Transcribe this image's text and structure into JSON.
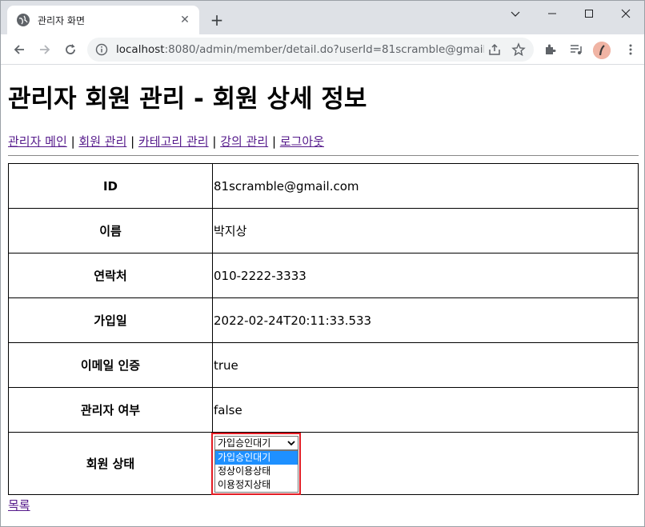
{
  "browser": {
    "tab_title": "관리자 화면",
    "new_tab_label": "+",
    "url_host": "localhost",
    "url_rest": ":8080/admin/member/detail.do?userId=81scramble@gmail.c..."
  },
  "page": {
    "title": "관리자 회원 관리 - 회원 상세 정보",
    "nav": {
      "items": [
        "관리자 메인",
        "회원 관리",
        "카테고리 관리",
        "강의 관리",
        "로그아웃"
      ],
      "separator": "|"
    },
    "detail": {
      "rows": [
        {
          "label": "ID",
          "value": "81scramble@gmail.com"
        },
        {
          "label": "이름",
          "value": "박지상"
        },
        {
          "label": "연락처",
          "value": "010-2222-3333"
        },
        {
          "label": "가입일",
          "value": "2022-02-24T20:11:33.533"
        },
        {
          "label": "이메일 인증",
          "value": "true"
        },
        {
          "label": "관리자 여부",
          "value": "false"
        }
      ],
      "status_label": "회원 상태",
      "status_selected": "가입승인대기",
      "status_options": [
        "가입승인대기",
        "정상이용상태",
        "이용정지상태"
      ]
    },
    "list_link": "목록"
  },
  "colors": {
    "link_visited": "#551a8b",
    "highlight": "#e31b23",
    "option_selected_bg": "#1e90ff"
  }
}
